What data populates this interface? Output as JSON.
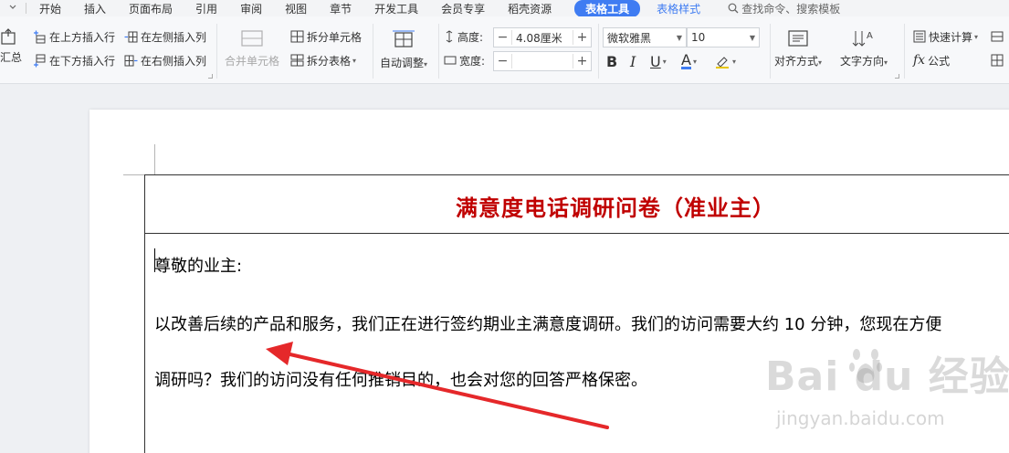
{
  "menubar": {
    "quick_access": "ᯓ",
    "items": [
      "开始",
      "插入",
      "页面布局",
      "引用",
      "审阅",
      "视图",
      "章节",
      "开发工具",
      "会员专享",
      "稻壳资源"
    ],
    "active_tab": "表格工具",
    "secondary_tab": "表格样式",
    "search_label": "查找命令、搜索模板"
  },
  "ribbon": {
    "summary": "汇总",
    "insert_above": "在上方插入行",
    "insert_below": "在下方插入行",
    "insert_left": "在左侧插入列",
    "insert_right": "在右侧插入列",
    "merge_cells": "合并单元格",
    "split_cells": "拆分单元格",
    "split_table": "拆分表格",
    "auto_fit": "自动调整",
    "height_label": "高度:",
    "height_value": "4.08厘米",
    "width_label": "宽度:",
    "width_value": "",
    "font_name": "微软雅黑",
    "font_size": "10",
    "align": "对齐方式",
    "text_direction": "文字方向",
    "quick_calc": "快速计算",
    "formula": "公式",
    "bold": "B",
    "italic": "I",
    "underline": "U",
    "font_color": "A"
  },
  "document": {
    "title": "满意度电话调研问卷（准业主）",
    "salutation": "尊敬的业主:",
    "line1": "以改善后续的产品和服务，我们正在进行签约期业主满意度调研。我们的访问需要大约 10 分钟，您现在方便",
    "line2": "调研吗？我们的访问没有任何推销目的，也会对您的回答严格保密。"
  },
  "watermark": {
    "logo_text": "Bai  du 经验",
    "site": "jingyan.baidu.com"
  },
  "colors": {
    "accent": "#3f7cf2",
    "title_red": "#c00000",
    "arrow_red": "#e5282a"
  }
}
